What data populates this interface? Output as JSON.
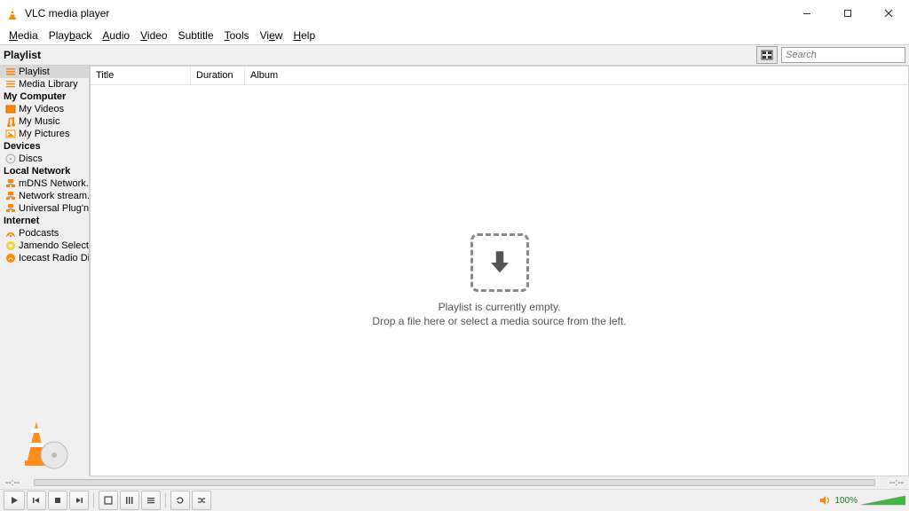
{
  "app": {
    "title": "VLC media player"
  },
  "menubar": [
    {
      "label": "Media",
      "u": 0
    },
    {
      "label": "Playback",
      "u": 4
    },
    {
      "label": "Audio",
      "u": 0
    },
    {
      "label": "Video",
      "u": 0
    },
    {
      "label": "Subtitle",
      "u": -1
    },
    {
      "label": "Tools",
      "u": 0
    },
    {
      "label": "View",
      "u": 2
    },
    {
      "label": "Help",
      "u": 0
    }
  ],
  "toolbar": {
    "section_label": "Playlist",
    "search_placeholder": "Search"
  },
  "sidebar": {
    "groups": [
      {
        "cat": null,
        "items": [
          {
            "label": "Playlist",
            "icon": "playlist",
            "selected": true
          },
          {
            "label": "Media Library",
            "icon": "library"
          }
        ]
      },
      {
        "cat": "My Computer",
        "items": [
          {
            "label": "My Videos",
            "icon": "video"
          },
          {
            "label": "My Music",
            "icon": "music"
          },
          {
            "label": "My Pictures",
            "icon": "picture"
          }
        ]
      },
      {
        "cat": "Devices",
        "items": [
          {
            "label": "Discs",
            "icon": "disc"
          }
        ]
      },
      {
        "cat": "Local Network",
        "items": [
          {
            "label": "mDNS Network...",
            "icon": "net"
          },
          {
            "label": "Network stream...",
            "icon": "net"
          },
          {
            "label": "Universal Plug'n...",
            "icon": "net"
          }
        ]
      },
      {
        "cat": "Internet",
        "items": [
          {
            "label": "Podcasts",
            "icon": "podcast"
          },
          {
            "label": "Jamendo Selecti...",
            "icon": "jamendo"
          },
          {
            "label": "Icecast Radio Di...",
            "icon": "icecast"
          }
        ]
      }
    ]
  },
  "list_header": {
    "title": "Title",
    "duration": "Duration",
    "album": "Album"
  },
  "empty": {
    "line1": "Playlist is currently empty.",
    "line2": "Drop a file here or select a media source from the left."
  },
  "seek": {
    "elapsed": "--:--",
    "remaining": "--:--"
  },
  "volume": {
    "percent": "100%"
  }
}
